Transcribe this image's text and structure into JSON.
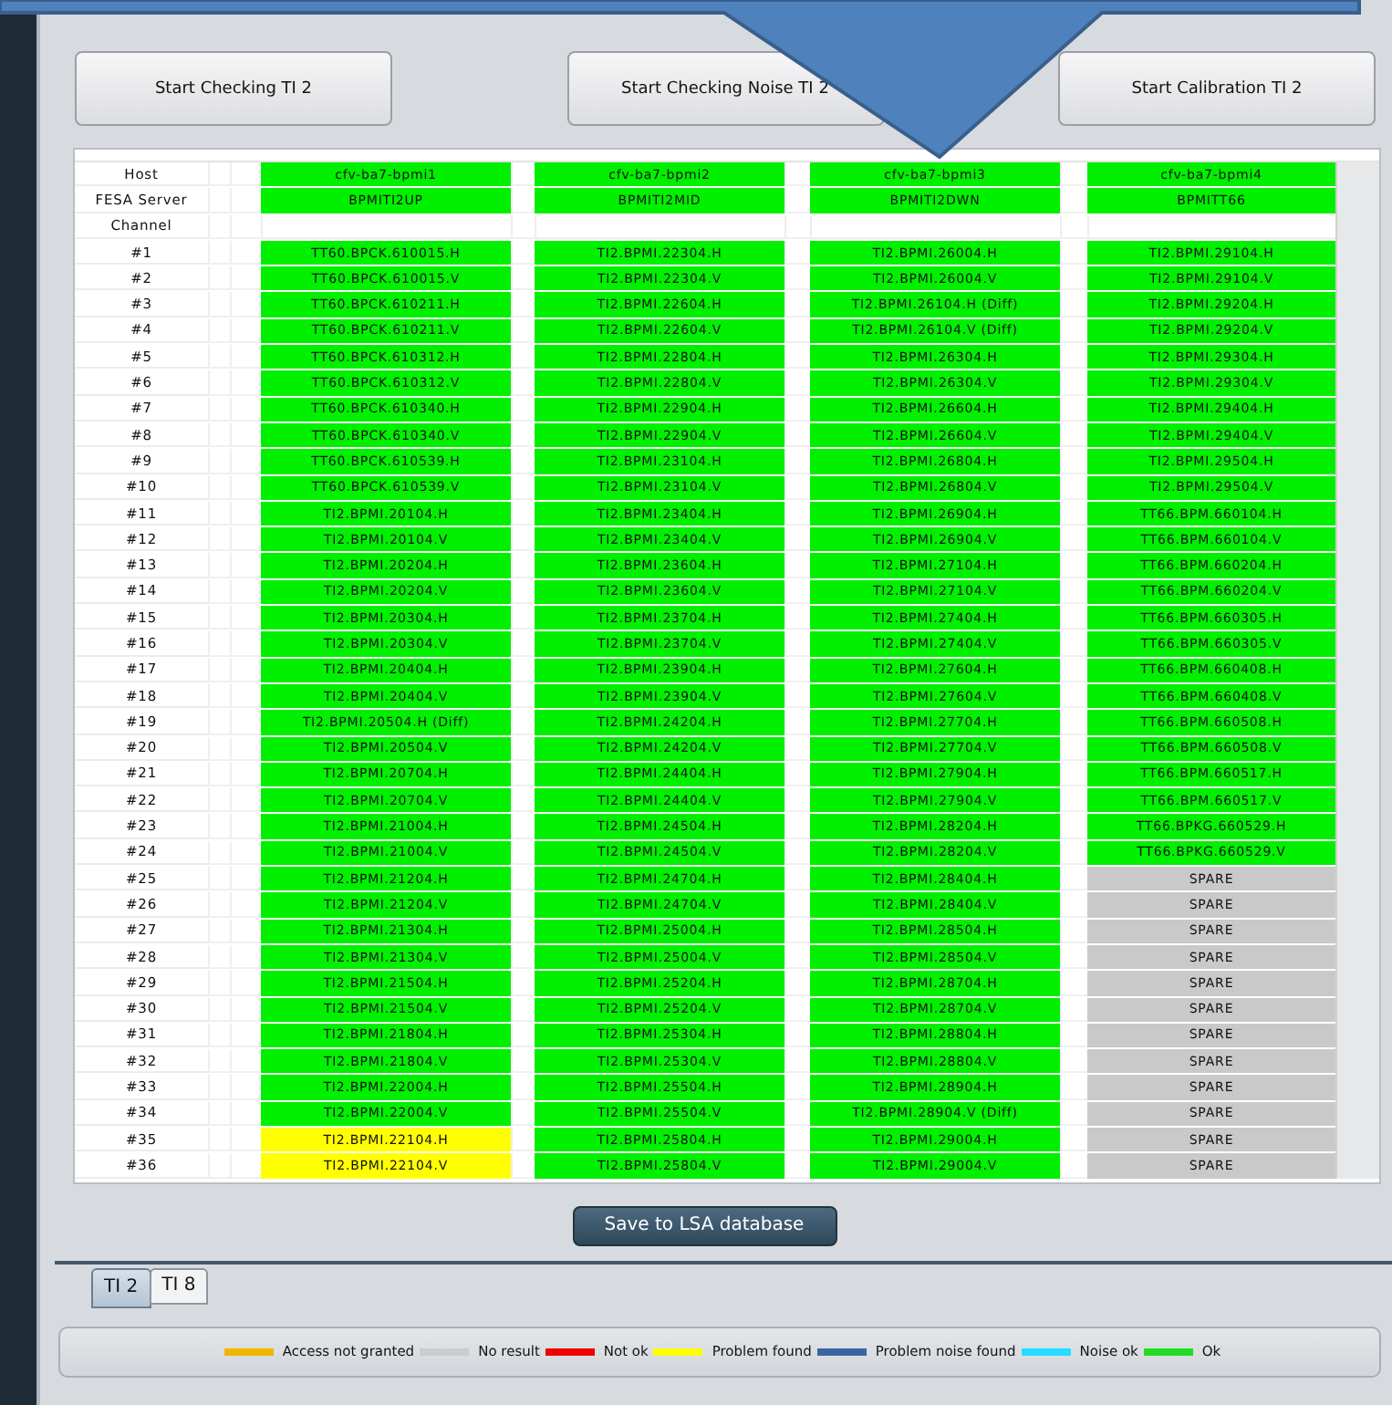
{
  "buttons": [
    "Start Checking TI 2",
    "Start Checking Noise TI 2",
    "Start Calibration TI 2"
  ],
  "table": {
    "row_labels": [
      "Host",
      "FESA Server",
      "Channel"
    ],
    "channel_labels": [
      "#1",
      "#2",
      "#3",
      "#4",
      "#5",
      "#6",
      "#7",
      "#8",
      "#9",
      "#10",
      "#11",
      "#12",
      "#13",
      "#14",
      "#15",
      "#16",
      "#17",
      "#18",
      "#19",
      "#20",
      "#21",
      "#22",
      "#23",
      "#24",
      "#25",
      "#26",
      "#27",
      "#28",
      "#29",
      "#30",
      "#31",
      "#32",
      "#33",
      "#34",
      "#35",
      "#36"
    ],
    "columns": [
      {
        "host": "cfv-ba7-bpmi1",
        "fesa_server": "BPMITI2UP",
        "channels": [
          {
            "text": "TT60.BPCK.610015.H",
            "color": "#00f000"
          },
          {
            "text": "TT60.BPCK.610015.V",
            "color": "#00f000"
          },
          {
            "text": "TT60.BPCK.610211.H",
            "color": "#00f000"
          },
          {
            "text": "TT60.BPCK.610211.V",
            "color": "#00f000"
          },
          {
            "text": "TT60.BPCK.610312.H",
            "color": "#00f000"
          },
          {
            "text": "TT60.BPCK.610312.V",
            "color": "#00f000"
          },
          {
            "text": "TT60.BPCK.610340.H",
            "color": "#00f000"
          },
          {
            "text": "TT60.BPCK.610340.V",
            "color": "#00f000"
          },
          {
            "text": "TT60.BPCK.610539.H",
            "color": "#00f000"
          },
          {
            "text": "TT60.BPCK.610539.V",
            "color": "#00f000"
          },
          {
            "text": "TI2.BPMI.20104.H",
            "color": "#00f000"
          },
          {
            "text": "TI2.BPMI.20104.V",
            "color": "#00f000"
          },
          {
            "text": "TI2.BPMI.20204.H",
            "color": "#00f000"
          },
          {
            "text": "TI2.BPMI.20204.V",
            "color": "#00f000"
          },
          {
            "text": "TI2.BPMI.20304.H",
            "color": "#00f000"
          },
          {
            "text": "TI2.BPMI.20304.V",
            "color": "#00f000"
          },
          {
            "text": "TI2.BPMI.20404.H",
            "color": "#00f000"
          },
          {
            "text": "TI2.BPMI.20404.V",
            "color": "#00f000"
          },
          {
            "text": "TI2.BPMI.20504.H (Diff)",
            "color": "#00f000"
          },
          {
            "text": "TI2.BPMI.20504.V",
            "color": "#00f000"
          },
          {
            "text": "TI2.BPMI.20704.H",
            "color": "#00f000"
          },
          {
            "text": "TI2.BPMI.20704.V",
            "color": "#00f000"
          },
          {
            "text": "TI2.BPMI.21004.H",
            "color": "#00f000"
          },
          {
            "text": "TI2.BPMI.21004.V",
            "color": "#00f000"
          },
          {
            "text": "TI2.BPMI.21204.H",
            "color": "#00f000"
          },
          {
            "text": "TI2.BPMI.21204.V",
            "color": "#00f000"
          },
          {
            "text": "TI2.BPMI.21304.H",
            "color": "#00f000"
          },
          {
            "text": "TI2.BPMI.21304.V",
            "color": "#00f000"
          },
          {
            "text": "TI2.BPMI.21504.H",
            "color": "#00f000"
          },
          {
            "text": "TI2.BPMI.21504.V",
            "color": "#00f000"
          },
          {
            "text": "TI2.BPMI.21804.H",
            "color": "#00f000"
          },
          {
            "text": "TI2.BPMI.21804.V",
            "color": "#00f000"
          },
          {
            "text": "TI2.BPMI.22004.H",
            "color": "#00f000"
          },
          {
            "text": "TI2.BPMI.22004.V",
            "color": "#00f000"
          },
          {
            "text": "TI2.BPMI.22104.H",
            "color": "#ffff00"
          },
          {
            "text": "TI2.BPMI.22104.V",
            "color": "#ffff00"
          }
        ]
      },
      {
        "host": "cfv-ba7-bpmi2",
        "fesa_server": "BPMITI2MID",
        "channels": [
          {
            "text": "TI2.BPMI.22304.H",
            "color": "#00f000"
          },
          {
            "text": "TI2.BPMI.22304.V",
            "color": "#00f000"
          },
          {
            "text": "TI2.BPMI.22604.H",
            "color": "#00f000"
          },
          {
            "text": "TI2.BPMI.22604.V",
            "color": "#00f000"
          },
          {
            "text": "TI2.BPMI.22804.H",
            "color": "#00f000"
          },
          {
            "text": "TI2.BPMI.22804.V",
            "color": "#00f000"
          },
          {
            "text": "TI2.BPMI.22904.H",
            "color": "#00f000"
          },
          {
            "text": "TI2.BPMI.22904.V",
            "color": "#00f000"
          },
          {
            "text": "TI2.BPMI.23104.H",
            "color": "#00f000"
          },
          {
            "text": "TI2.BPMI.23104.V",
            "color": "#00f000"
          },
          {
            "text": "TI2.BPMI.23404.H",
            "color": "#00f000"
          },
          {
            "text": "TI2.BPMI.23404.V",
            "color": "#00f000"
          },
          {
            "text": "TI2.BPMI.23604.H",
            "color": "#00f000"
          },
          {
            "text": "TI2.BPMI.23604.V",
            "color": "#00f000"
          },
          {
            "text": "TI2.BPMI.23704.H",
            "color": "#00f000"
          },
          {
            "text": "TI2.BPMI.23704.V",
            "color": "#00f000"
          },
          {
            "text": "TI2.BPMI.23904.H",
            "color": "#00f000"
          },
          {
            "text": "TI2.BPMI.23904.V",
            "color": "#00f000"
          },
          {
            "text": "TI2.BPMI.24204.H",
            "color": "#00f000"
          },
          {
            "text": "TI2.BPMI.24204.V",
            "color": "#00f000"
          },
          {
            "text": "TI2.BPMI.24404.H",
            "color": "#00f000"
          },
          {
            "text": "TI2.BPMI.24404.V",
            "color": "#00f000"
          },
          {
            "text": "TI2.BPMI.24504.H",
            "color": "#00f000"
          },
          {
            "text": "TI2.BPMI.24504.V",
            "color": "#00f000"
          },
          {
            "text": "TI2.BPMI.24704.H",
            "color": "#00f000"
          },
          {
            "text": "TI2.BPMI.24704.V",
            "color": "#00f000"
          },
          {
            "text": "TI2.BPMI.25004.H",
            "color": "#00f000"
          },
          {
            "text": "TI2.BPMI.25004.V",
            "color": "#00f000"
          },
          {
            "text": "TI2.BPMI.25204.H",
            "color": "#00f000"
          },
          {
            "text": "TI2.BPMI.25204.V",
            "color": "#00f000"
          },
          {
            "text": "TI2.BPMI.25304.H",
            "color": "#00f000"
          },
          {
            "text": "TI2.BPMI.25304.V",
            "color": "#00f000"
          },
          {
            "text": "TI2.BPMI.25504.H",
            "color": "#00f000"
          },
          {
            "text": "TI2.BPMI.25504.V",
            "color": "#00f000"
          },
          {
            "text": "TI2.BPMI.25804.H",
            "color": "#00f000"
          },
          {
            "text": "TI2.BPMI.25804.V",
            "color": "#00f000"
          }
        ]
      },
      {
        "host": "cfv-ba7-bpmi3",
        "fesa_server": "BPMITI2DWN",
        "channels": [
          {
            "text": "TI2.BPMI.26004.H",
            "color": "#00f000"
          },
          {
            "text": "TI2.BPMI.26004.V",
            "color": "#00f000"
          },
          {
            "text": "TI2.BPMI.26104.H (Diff)",
            "color": "#00f000"
          },
          {
            "text": "TI2.BPMI.26104.V (Diff)",
            "color": "#00f000"
          },
          {
            "text": "TI2.BPMI.26304.H",
            "color": "#00f000"
          },
          {
            "text": "TI2.BPMI.26304.V",
            "color": "#00f000"
          },
          {
            "text": "TI2.BPMI.26604.H",
            "color": "#00f000"
          },
          {
            "text": "TI2.BPMI.26604.V",
            "color": "#00f000"
          },
          {
            "text": "TI2.BPMI.26804.H",
            "color": "#00f000"
          },
          {
            "text": "TI2.BPMI.26804.V",
            "color": "#00f000"
          },
          {
            "text": "TI2.BPMI.26904.H",
            "color": "#00f000"
          },
          {
            "text": "TI2.BPMI.26904.V",
            "color": "#00f000"
          },
          {
            "text": "TI2.BPMI.27104.H",
            "color": "#00f000"
          },
          {
            "text": "TI2.BPMI.27104.V",
            "color": "#00f000"
          },
          {
            "text": "TI2.BPMI.27404.H",
            "color": "#00f000"
          },
          {
            "text": "TI2.BPMI.27404.V",
            "color": "#00f000"
          },
          {
            "text": "TI2.BPMI.27604.H",
            "color": "#00f000"
          },
          {
            "text": "TI2.BPMI.27604.V",
            "color": "#00f000"
          },
          {
            "text": "TI2.BPMI.27704.H",
            "color": "#00f000"
          },
          {
            "text": "TI2.BPMI.27704.V",
            "color": "#00f000"
          },
          {
            "text": "TI2.BPMI.27904.H",
            "color": "#00f000"
          },
          {
            "text": "TI2.BPMI.27904.V",
            "color": "#00f000"
          },
          {
            "text": "TI2.BPMI.28204.H",
            "color": "#00f000"
          },
          {
            "text": "TI2.BPMI.28204.V",
            "color": "#00f000"
          },
          {
            "text": "TI2.BPMI.28404.H",
            "color": "#00f000"
          },
          {
            "text": "TI2.BPMI.28404.V",
            "color": "#00f000"
          },
          {
            "text": "TI2.BPMI.28504.H",
            "color": "#00f000"
          },
          {
            "text": "TI2.BPMI.28504.V",
            "color": "#00f000"
          },
          {
            "text": "TI2.BPMI.28704.H",
            "color": "#00f000"
          },
          {
            "text": "TI2.BPMI.28704.V",
            "color": "#00f000"
          },
          {
            "text": "TI2.BPMI.28804.H",
            "color": "#00f000"
          },
          {
            "text": "TI2.BPMI.28804.V",
            "color": "#00f000"
          },
          {
            "text": "TI2.BPMI.28904.H",
            "color": "#00f000"
          },
          {
            "text": "TI2.BPMI.28904.V (Diff)",
            "color": "#00f000"
          },
          {
            "text": "TI2.BPMI.29004.H",
            "color": "#00f000"
          },
          {
            "text": "TI2.BPMI.29004.V",
            "color": "#00f000"
          }
        ]
      },
      {
        "host": "cfv-ba7-bpmi4",
        "fesa_server": "BPMITT66",
        "channels": [
          {
            "text": "TI2.BPMI.29104.H",
            "color": "#00f000"
          },
          {
            "text": "TI2.BPMI.29104.V",
            "color": "#00f000"
          },
          {
            "text": "TI2.BPMI.29204.H",
            "color": "#00f000"
          },
          {
            "text": "TI2.BPMI.29204.V",
            "color": "#00f000"
          },
          {
            "text": "TI2.BPMI.29304.H",
            "color": "#00f000"
          },
          {
            "text": "TI2.BPMI.29304.V",
            "color": "#00f000"
          },
          {
            "text": "TI2.BPMI.29404.H",
            "color": "#00f000"
          },
          {
            "text": "TI2.BPMI.29404.V",
            "color": "#00f000"
          },
          {
            "text": "TI2.BPMI.29504.H",
            "color": "#00f000"
          },
          {
            "text": "TI2.BPMI.29504.V",
            "color": "#00f000"
          },
          {
            "text": "TT66.BPM.660104.H",
            "color": "#00f000"
          },
          {
            "text": "TT66.BPM.660104.V",
            "color": "#00f000"
          },
          {
            "text": "TT66.BPM.660204.H",
            "color": "#00f000"
          },
          {
            "text": "TT66.BPM.660204.V",
            "color": "#00f000"
          },
          {
            "text": "TT66.BPM.660305.H",
            "color": "#00f000"
          },
          {
            "text": "TT66.BPM.660305.V",
            "color": "#00f000"
          },
          {
            "text": "TT66.BPM.660408.H",
            "color": "#00f000"
          },
          {
            "text": "TT66.BPM.660408.V",
            "color": "#00f000"
          },
          {
            "text": "TT66.BPM.660508.H",
            "color": "#00f000"
          },
          {
            "text": "TT66.BPM.660508.V",
            "color": "#00f000"
          },
          {
            "text": "TT66.BPM.660517.H",
            "color": "#00f000"
          },
          {
            "text": "TT66.BPM.660517.V",
            "color": "#00f000"
          },
          {
            "text": "TT66.BPKG.660529.H",
            "color": "#00f000"
          },
          {
            "text": "TT66.BPKG.660529.V",
            "color": "#00f000"
          },
          {
            "text": "SPARE",
            "color": "#c9c9c9"
          },
          {
            "text": "SPARE",
            "color": "#c9c9c9"
          },
          {
            "text": "SPARE",
            "color": "#c9c9c9"
          },
          {
            "text": "SPARE",
            "color": "#c9c9c9"
          },
          {
            "text": "SPARE",
            "color": "#c9c9c9"
          },
          {
            "text": "SPARE",
            "color": "#c9c9c9"
          },
          {
            "text": "SPARE",
            "color": "#c9c9c9"
          },
          {
            "text": "SPARE",
            "color": "#c9c9c9"
          },
          {
            "text": "SPARE",
            "color": "#c9c9c9"
          },
          {
            "text": "SPARE",
            "color": "#c9c9c9"
          },
          {
            "text": "SPARE",
            "color": "#c9c9c9"
          },
          {
            "text": "SPARE",
            "color": "#c9c9c9"
          }
        ]
      }
    ]
  },
  "save_button": "Save to LSA database",
  "tabs": [
    {
      "label": "TI 2",
      "selected": true
    },
    {
      "label": "TI 8",
      "selected": false
    }
  ],
  "legend": [
    {
      "label": "Access not granted",
      "color": "#f2b500"
    },
    {
      "label": "No result",
      "color": "#cccccc"
    },
    {
      "label": "Not ok",
      "color": "#ee0000"
    },
    {
      "label": "Problem found",
      "color": "#ffff00"
    },
    {
      "label": "Problem noise found",
      "color": "#3a65a0"
    },
    {
      "label": "Noise ok",
      "color": "#22ddff"
    },
    {
      "label": "Ok",
      "color": "#22dd22"
    }
  ]
}
